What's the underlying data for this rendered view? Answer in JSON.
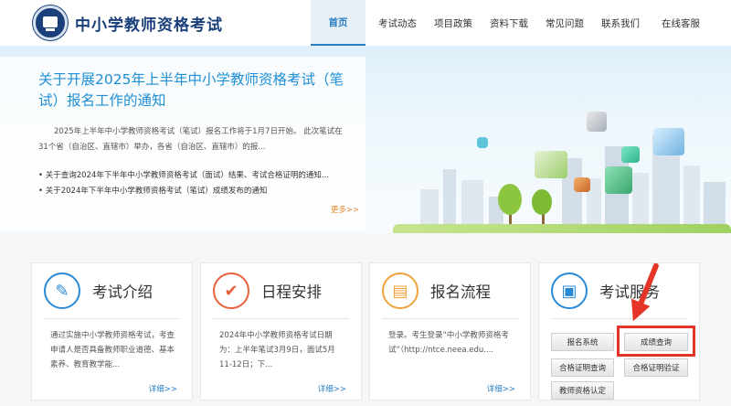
{
  "header": {
    "site_title": "中小学教师资格考试",
    "nav": [
      "首页",
      "考试动态",
      "项目政策",
      "资料下载",
      "常见问题",
      "联系我们",
      "在线客服"
    ]
  },
  "banner": {
    "title": "关于开展2025年上半年中小学教师资格考试（笔试）报名工作的通知",
    "summary": "2025年上半年中小学教师资格考试（笔试）报名工作将于1月7日开始。 此次笔试在31个省（自治区、直辖市）举办，各省（自治区、直辖市）的报...",
    "links": [
      "关于查询2024年下半年中小学教师资格考试（面试）结果、考试合格证明的通知...",
      "关于2024年下半年中小学教师资格考试（笔试）成绩发布的通知"
    ],
    "more": "更多>>"
  },
  "cards": [
    {
      "title": "考试介绍",
      "text": "通过实施中小学教师资格考试，考查申请人是否具备教师职业道德、基本素养、教育教学能...",
      "more": "详细>>",
      "icon": "exam-intro-icon"
    },
    {
      "title": "日程安排",
      "text": "2024年中小学教师资格考试日期为：上半年笔试3月9日，面试5月11-12日；下...",
      "more": "详细>>",
      "icon": "schedule-check-icon"
    },
    {
      "title": "报名流程",
      "text": "登录。考生登录“中小学教师资格考试”（http://ntce.neea.edu....",
      "more": "详细>>",
      "icon": "registration-flow-icon"
    },
    {
      "title": "考试服务",
      "icon": "exam-service-icon"
    }
  ],
  "services": {
    "register_system": "报名系统",
    "score_query": "成绩查询",
    "cert_query": "合格证明查询",
    "cert_verify": "合格证明验证",
    "qualification": "教师资格认定"
  },
  "colors": {
    "brand": "#1a3f7a",
    "link": "#1f8fd6",
    "highlight": "#e53528"
  }
}
